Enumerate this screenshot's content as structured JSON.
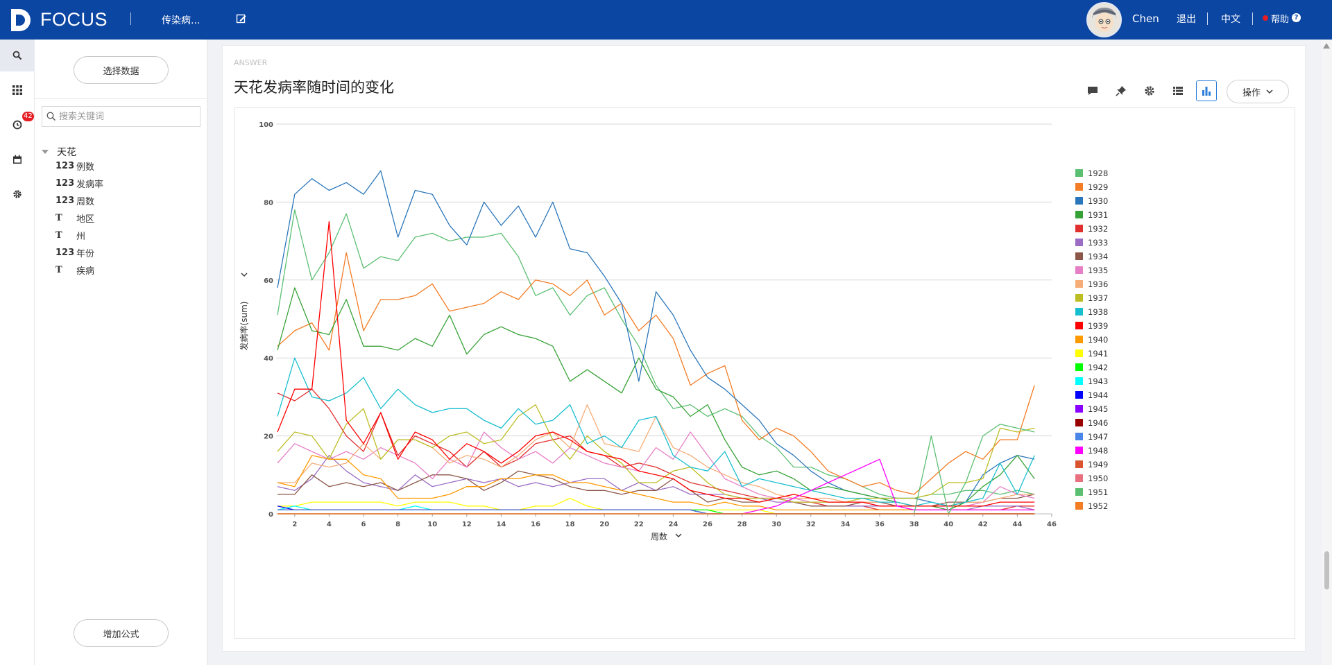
{
  "header": {
    "logo_text": "FOCUS",
    "dataset_name": "传染病...",
    "username": "Chen",
    "logout": "退出",
    "language": "中文",
    "help": "帮助",
    "help_mark": "?",
    "brand_color": "#0c46a3"
  },
  "rail": {
    "icons": [
      "search-icon",
      "grid-icon",
      "history-icon",
      "calendar-icon",
      "gear-icon"
    ],
    "history_badge": "42"
  },
  "left_panel": {
    "select_data": "选择数据",
    "search_placeholder": "搜索关键词",
    "root": "天花",
    "fields": [
      {
        "type": "123",
        "name": "例数"
      },
      {
        "type": "123",
        "name": "发病率"
      },
      {
        "type": "123",
        "name": "周数"
      },
      {
        "type": "T",
        "name": "地区"
      },
      {
        "type": "T",
        "name": "州"
      },
      {
        "type": "123",
        "name": "年份"
      },
      {
        "type": "T",
        "name": "疾病"
      }
    ],
    "add_formula": "增加公式"
  },
  "answer": {
    "label": "ANSWER",
    "title": "天花发病率随时间的变化",
    "ops_label": "操作",
    "toolbar_icons": [
      "comment-icon",
      "pin-icon",
      "settings-icon",
      "table-icon",
      "bar-chart-icon"
    ]
  },
  "chart_data": {
    "type": "line",
    "xlabel": "周数",
    "ylabel": "发病率(sum)",
    "xlim": [
      1,
      46
    ],
    "ylim": [
      0,
      100
    ],
    "x_ticks": [
      2,
      4,
      6,
      8,
      10,
      12,
      14,
      16,
      18,
      20,
      22,
      24,
      26,
      28,
      30,
      32,
      34,
      36,
      38,
      40,
      42,
      44,
      46
    ],
    "y_ticks": [
      0,
      20,
      40,
      60,
      80,
      100
    ],
    "grid": "horizontal",
    "legend_position": "right",
    "series": [
      {
        "name": "1928",
        "color": "#5bbf72",
        "values": [
          51,
          78,
          60,
          67,
          77,
          63,
          66,
          65,
          71,
          72,
          70,
          71,
          71,
          72,
          66,
          56,
          58,
          51,
          56,
          58,
          50,
          43,
          33,
          27,
          28,
          25,
          27,
          25,
          20,
          17,
          12,
          12,
          10,
          9,
          7,
          5,
          4,
          4,
          5,
          5,
          6,
          6,
          5,
          6,
          5
        ]
      },
      {
        "name": "1929",
        "color": "#f47c25",
        "values": [
          43,
          47,
          49,
          42,
          67,
          47,
          55,
          55,
          56,
          59,
          52,
          53,
          54,
          57,
          55,
          60,
          59,
          56,
          60,
          51,
          54,
          47,
          51,
          45,
          33,
          36,
          38,
          24,
          19,
          22,
          20,
          16,
          11,
          9,
          7,
          8,
          6,
          5,
          9,
          13,
          16,
          14,
          19,
          19,
          33
        ]
      },
      {
        "name": "1930",
        "color": "#2a76ba",
        "values": [
          58,
          82,
          86,
          83,
          85,
          82,
          88,
          71,
          83,
          82,
          74,
          69,
          80,
          74,
          79,
          71,
          80,
          68,
          67,
          61,
          54,
          34,
          57,
          51,
          42,
          35,
          32,
          28,
          24,
          18,
          15,
          11,
          8,
          6,
          5,
          4,
          4,
          4,
          3,
          2,
          3,
          10,
          13,
          15,
          14
        ]
      },
      {
        "name": "1931",
        "color": "#36a236",
        "values": [
          42,
          58,
          47,
          46,
          55,
          43,
          43,
          42,
          45,
          43,
          51,
          41,
          46,
          48,
          46,
          45,
          43,
          34,
          37,
          34,
          31,
          40,
          32,
          30,
          25,
          28,
          19,
          12,
          10,
          11,
          9,
          6,
          7,
          6,
          5,
          4,
          3,
          2,
          2,
          1,
          3,
          7,
          10,
          15,
          9
        ]
      },
      {
        "name": "1932",
        "color": "#e12e2e",
        "values": [
          31,
          29,
          32,
          27,
          20,
          16,
          26,
          15,
          20,
          18,
          16,
          12,
          16,
          12,
          14,
          18,
          19,
          20,
          16,
          15,
          12,
          13,
          12,
          10,
          8,
          7,
          6,
          5,
          4,
          4,
          3,
          3,
          2,
          2,
          2,
          1,
          1,
          1,
          1,
          1,
          1,
          1,
          1,
          2,
          2
        ]
      },
      {
        "name": "1933",
        "color": "#9a6cc4",
        "values": [
          7,
          6,
          9,
          15,
          11,
          8,
          7,
          6,
          10,
          7,
          8,
          9,
          8,
          9,
          7,
          8,
          7,
          8,
          9,
          9,
          6,
          8,
          6,
          7,
          5,
          5,
          5,
          4,
          4,
          3,
          3,
          2,
          2,
          2,
          2,
          2,
          2,
          1,
          1,
          1,
          1,
          2,
          2,
          2,
          1
        ]
      },
      {
        "name": "1934",
        "color": "#8c5648",
        "values": [
          5,
          5,
          10,
          7,
          8,
          7,
          8,
          6,
          8,
          10,
          10,
          9,
          6,
          8,
          11,
          10,
          9,
          7,
          6,
          6,
          5,
          6,
          6,
          9,
          6,
          3,
          4,
          3,
          3,
          4,
          3,
          2,
          2,
          2,
          3,
          3,
          2,
          2,
          2,
          3,
          3,
          3,
          4,
          4,
          5
        ]
      },
      {
        "name": "1935",
        "color": "#e77fc6",
        "values": [
          13,
          18,
          16,
          14,
          16,
          14,
          17,
          15,
          13,
          9,
          14,
          12,
          21,
          17,
          14,
          16,
          13,
          17,
          15,
          13,
          12,
          11,
          17,
          14,
          21,
          15,
          9,
          7,
          5,
          4,
          4,
          3,
          3,
          3,
          3,
          2,
          2,
          2,
          2,
          2,
          2,
          3,
          7,
          5,
          4
        ]
      },
      {
        "name": "1936",
        "color": "#f6ad78",
        "values": [
          8,
          8,
          13,
          12,
          13,
          18,
          14,
          19,
          19,
          17,
          13,
          15,
          14,
          12,
          15,
          19,
          21,
          17,
          28,
          18,
          17,
          16,
          25,
          17,
          15,
          12,
          10,
          8,
          7,
          5,
          4,
          4,
          4,
          3,
          3,
          3,
          3,
          2,
          2,
          2,
          3,
          3,
          4,
          5,
          5
        ]
      },
      {
        "name": "1937",
        "color": "#bcbd22",
        "values": [
          16,
          21,
          20,
          14,
          23,
          27,
          14,
          19,
          19,
          17,
          20,
          21,
          18,
          19,
          25,
          28,
          19,
          14,
          20,
          16,
          13,
          8,
          8,
          11,
          12,
          8,
          5,
          4,
          4,
          4,
          3,
          3,
          3,
          3,
          4,
          4,
          4,
          4,
          5,
          8,
          8,
          9,
          22,
          21,
          22
        ]
      },
      {
        "name": "1938",
        "color": "#17becf",
        "values": [
          25,
          40,
          30,
          29,
          31,
          35,
          27,
          32,
          28,
          26,
          27,
          27,
          24,
          22,
          27,
          23,
          24,
          28,
          18,
          20,
          17,
          24,
          25,
          15,
          12,
          11,
          16,
          7,
          9,
          8,
          7,
          6,
          5,
          4,
          4,
          3,
          3,
          2,
          3,
          2,
          3,
          4,
          13,
          5,
          15
        ]
      },
      {
        "name": "1939",
        "color": "#ff0000",
        "values": [
          21,
          32,
          32,
          75,
          24,
          18,
          26,
          14,
          21,
          19,
          14,
          18,
          16,
          13,
          16,
          20,
          21,
          19,
          16,
          15,
          14,
          11,
          10,
          9,
          6,
          5,
          4,
          4,
          3,
          4,
          5,
          4,
          3,
          3,
          3,
          2,
          2,
          2,
          2,
          2,
          2,
          2,
          3,
          3,
          3
        ]
      },
      {
        "name": "1940",
        "color": "#ff9900",
        "values": [
          8,
          7,
          15,
          14,
          14,
          10,
          9,
          4,
          4,
          4,
          5,
          7,
          7,
          9,
          9,
          10,
          10,
          8,
          8,
          7,
          6,
          5,
          4,
          3,
          3,
          2,
          3,
          2,
          2,
          1,
          1,
          1,
          1,
          1,
          1,
          1,
          1,
          1,
          1,
          1,
          1,
          1,
          1,
          1,
          1
        ]
      },
      {
        "name": "1941",
        "color": "#ffff00",
        "values": [
          2,
          2,
          3,
          3,
          3,
          3,
          3,
          2,
          3,
          3,
          3,
          2,
          2,
          1,
          1,
          2,
          2,
          4,
          2,
          1,
          1,
          1,
          1,
          1,
          1,
          1,
          1,
          1,
          1,
          0,
          0,
          0,
          0,
          0,
          0,
          0,
          0,
          0,
          0,
          0,
          0,
          0,
          0,
          0,
          0
        ]
      },
      {
        "name": "1942",
        "color": "#00ff00",
        "values": [
          1,
          1,
          1,
          1,
          1,
          1,
          1,
          1,
          1,
          1,
          1,
          1,
          1,
          1,
          1,
          1,
          1,
          1,
          1,
          1,
          1,
          1,
          1,
          1,
          1,
          1,
          0,
          0,
          0,
          0,
          0,
          0,
          0,
          0,
          0,
          0,
          0,
          0,
          0,
          0,
          0,
          0,
          0,
          0,
          0
        ]
      },
      {
        "name": "1943",
        "color": "#00ffff",
        "values": [
          1,
          2,
          1,
          1,
          1,
          1,
          1,
          1,
          2,
          1,
          1,
          1,
          1,
          1,
          1,
          1,
          1,
          1,
          1,
          1,
          1,
          1,
          1,
          1,
          1,
          0,
          0,
          0,
          0,
          0,
          0,
          0,
          0,
          0,
          0,
          0,
          0,
          0,
          0,
          0,
          0,
          0,
          0,
          0,
          0
        ]
      },
      {
        "name": "1944",
        "color": "#0000ff",
        "values": [
          2,
          1,
          1,
          1,
          1,
          1,
          1,
          1,
          1,
          1,
          1,
          1,
          1,
          1,
          1,
          1,
          1,
          1,
          1,
          1,
          1,
          1,
          1,
          1,
          1,
          0,
          0,
          0,
          0,
          0,
          0,
          0,
          0,
          0,
          0,
          0,
          0,
          0,
          0,
          0,
          0,
          0,
          0,
          0,
          0
        ]
      },
      {
        "name": "1945",
        "color": "#8800ff",
        "values": [
          1,
          1,
          1,
          1,
          1,
          1,
          1,
          1,
          1,
          1,
          1,
          1,
          1,
          1,
          1,
          1,
          1,
          1,
          1,
          1,
          1,
          1,
          1,
          1,
          1,
          0,
          0,
          0,
          0,
          0,
          0,
          0,
          0,
          0,
          0,
          0,
          0,
          0,
          0,
          0,
          0,
          0,
          0,
          0,
          0
        ]
      },
      {
        "name": "1946",
        "color": "#990000",
        "values": [
          1,
          1,
          1,
          1,
          1,
          1,
          1,
          1,
          1,
          1,
          1,
          1,
          1,
          1,
          1,
          1,
          1,
          1,
          1,
          1,
          1,
          1,
          1,
          1,
          1,
          0,
          0,
          0,
          0,
          0,
          0,
          0,
          0,
          0,
          0,
          0,
          0,
          0,
          0,
          0,
          0,
          0,
          0,
          0,
          0
        ]
      },
      {
        "name": "1947",
        "color": "#4a86e8",
        "values": [
          1,
          1,
          1,
          1,
          1,
          1,
          1,
          1,
          1,
          1,
          1,
          1,
          1,
          1,
          1,
          1,
          1,
          1,
          1,
          1,
          1,
          1,
          1,
          1,
          1,
          0,
          0,
          0,
          0,
          0,
          0,
          0,
          0,
          0,
          0,
          0,
          0,
          0,
          0,
          0,
          0,
          0,
          0,
          0,
          0
        ]
      },
      {
        "name": "1948",
        "color": "#ff00ff",
        "values": [
          0,
          0,
          0,
          0,
          0,
          0,
          0,
          0,
          0,
          0,
          0,
          0,
          0,
          0,
          0,
          0,
          0,
          0,
          0,
          0,
          0,
          0,
          0,
          0,
          0,
          0,
          0,
          0,
          1,
          2,
          4,
          6,
          8,
          10,
          12,
          14,
          2,
          1,
          1,
          1,
          1,
          1,
          1,
          1,
          1
        ]
      },
      {
        "name": "1949",
        "color": "#d9542f",
        "values": [
          0,
          0,
          0,
          0,
          0,
          0,
          0,
          0,
          0,
          0,
          0,
          0,
          0,
          0,
          0,
          0,
          0,
          0,
          0,
          0,
          0,
          0,
          0,
          0,
          0,
          0,
          0,
          0,
          0,
          0,
          0,
          0,
          0,
          0,
          0,
          0,
          0,
          0,
          0,
          0,
          0,
          0,
          0,
          0,
          0
        ]
      },
      {
        "name": "1950",
        "color": "#e8707f",
        "values": [
          0,
          0,
          0,
          0,
          0,
          0,
          0,
          0,
          0,
          0,
          0,
          0,
          0,
          0,
          0,
          0,
          0,
          0,
          0,
          0,
          0,
          0,
          0,
          0,
          0,
          0,
          0,
          0,
          0,
          0,
          0,
          0,
          0,
          0,
          0,
          0,
          0,
          0,
          0,
          0,
          0,
          0,
          0,
          0,
          0
        ]
      },
      {
        "name": "1951",
        "color": "#5bbf72",
        "values": [
          0,
          0,
          0,
          0,
          0,
          0,
          0,
          0,
          0,
          0,
          0,
          0,
          0,
          0,
          0,
          0,
          0,
          0,
          0,
          0,
          0,
          0,
          0,
          0,
          0,
          0,
          0,
          0,
          0,
          0,
          0,
          0,
          0,
          0,
          0,
          0,
          0,
          0,
          20,
          0,
          8,
          20,
          23,
          22,
          21
        ]
      },
      {
        "name": "1952",
        "color": "#f47c25",
        "values": [
          0,
          0,
          0,
          0,
          0,
          0,
          0,
          0,
          0,
          0,
          0,
          0,
          0,
          0,
          0,
          0,
          0,
          0,
          0,
          0,
          0,
          0,
          0,
          0,
          0,
          0,
          0,
          0,
          0,
          0,
          0,
          0,
          0,
          0,
          0,
          0,
          0,
          0,
          0,
          0,
          0,
          0,
          0,
          0,
          0
        ]
      }
    ]
  }
}
